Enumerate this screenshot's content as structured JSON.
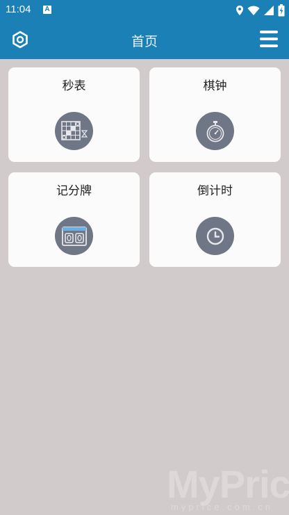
{
  "status_bar": {
    "time": "11:04",
    "notif_letter": "A"
  },
  "app_bar": {
    "title": "首页"
  },
  "cards": [
    {
      "label": "秒表",
      "icon": "chess-board-icon"
    },
    {
      "label": "棋钟",
      "icon": "stopwatch-icon"
    },
    {
      "label": "记分牌",
      "icon": "scoreboard-icon"
    },
    {
      "label": "倒计时",
      "icon": "clock-icon"
    }
  ],
  "watermark": {
    "brand": "MyPrice",
    "domain": "myprice.com.cn"
  },
  "colors": {
    "primary": "#1b80b5",
    "background": "#d2cbcb",
    "card": "#fbfbfb",
    "icon_circle": "#6f7686"
  }
}
